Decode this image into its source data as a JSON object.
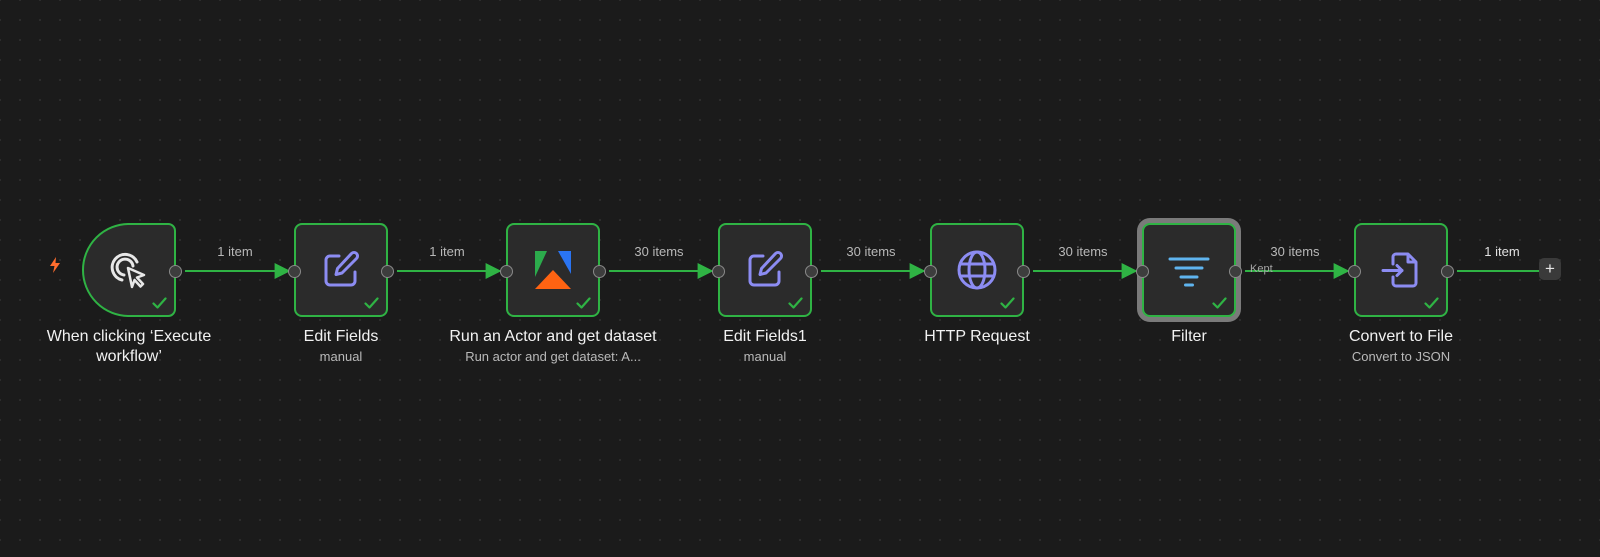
{
  "colors": {
    "canvas_background": "#1b1b1b",
    "node_background": "#2b2b2b",
    "success_green": "#2fb344",
    "trigger_orange": "#ff6d2e",
    "node_icon_purple": "#8c8cf2",
    "filter_icon_blue": "#5fb4ef",
    "selected_outline": "#7a7a7a"
  },
  "nodes": [
    {
      "id": "trigger",
      "title": "When clicking ‘Execute workflow’",
      "subtitle": "",
      "icon": "cursor-click-icon",
      "status": "success",
      "is_trigger": true
    },
    {
      "id": "edit-fields",
      "title": "Edit Fields",
      "subtitle": "manual",
      "icon": "pencil-square-icon",
      "status": "success"
    },
    {
      "id": "apify",
      "title": "Run an Actor and get dataset",
      "subtitle": "Run actor and get dataset: A...",
      "icon": "apify-logo-icon",
      "status": "success"
    },
    {
      "id": "edit-fields1",
      "title": "Edit Fields1",
      "subtitle": "manual",
      "icon": "pencil-square-icon",
      "status": "success"
    },
    {
      "id": "http",
      "title": "HTTP Request",
      "subtitle": "",
      "icon": "globe-icon",
      "status": "success"
    },
    {
      "id": "filter",
      "title": "Filter",
      "subtitle": "",
      "icon": "filter-icon",
      "status": "success",
      "selected": true
    },
    {
      "id": "convert",
      "title": "Convert to File",
      "subtitle": "Convert to JSON",
      "icon": "file-export-icon",
      "status": "success"
    }
  ],
  "edges": [
    {
      "from": "trigger",
      "to": "edit-fields",
      "label": "1 item"
    },
    {
      "from": "edit-fields",
      "to": "apify",
      "label": "1 item"
    },
    {
      "from": "apify",
      "to": "edit-fields1",
      "label": "30 items"
    },
    {
      "from": "edit-fields1",
      "to": "http",
      "label": "30 items"
    },
    {
      "from": "http",
      "to": "filter",
      "label": "30 items"
    },
    {
      "from": "filter",
      "to": "convert",
      "label": "30 items",
      "branch": "Kept"
    },
    {
      "from": "convert",
      "to": "add",
      "label": "1 item"
    }
  ],
  "trigger_indicator": "lightning-bolt-icon",
  "add_button": "+"
}
